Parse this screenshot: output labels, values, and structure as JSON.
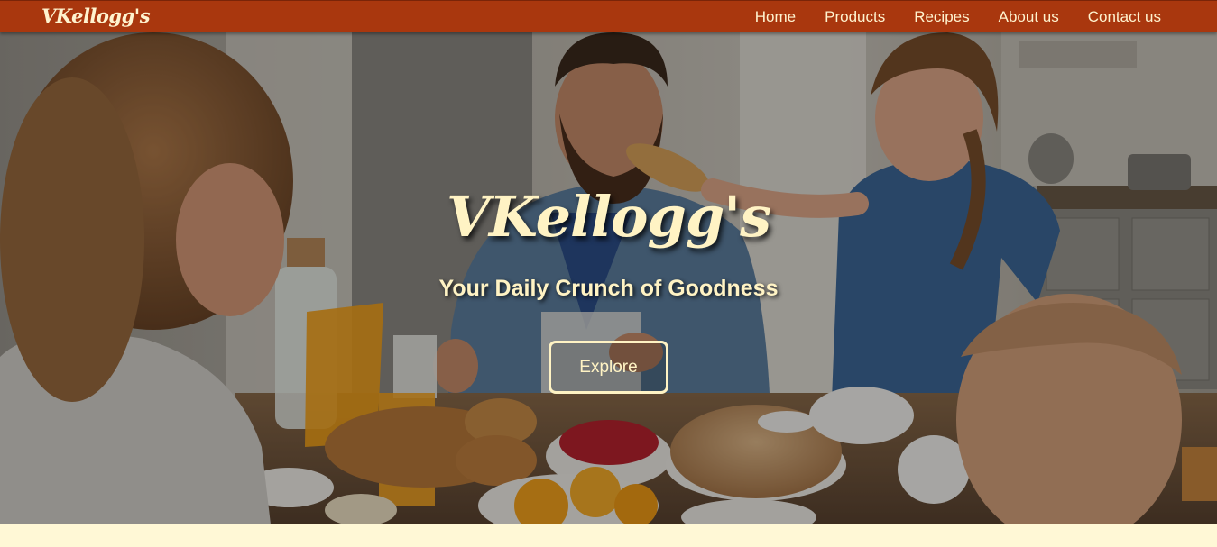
{
  "navbar": {
    "brand": "VKellogg's",
    "links": [
      "Home",
      "Products",
      "Recipes",
      "About us",
      "Contact us"
    ],
    "background_color": "#a9370e",
    "text_color": "#fff3cf"
  },
  "hero": {
    "title": "VKellogg's",
    "subtitle": "Your Daily Crunch of Goodness",
    "button_label": "Explore",
    "accent_color": "#fff3c4"
  },
  "page": {
    "background_color": "#fff8d6"
  }
}
